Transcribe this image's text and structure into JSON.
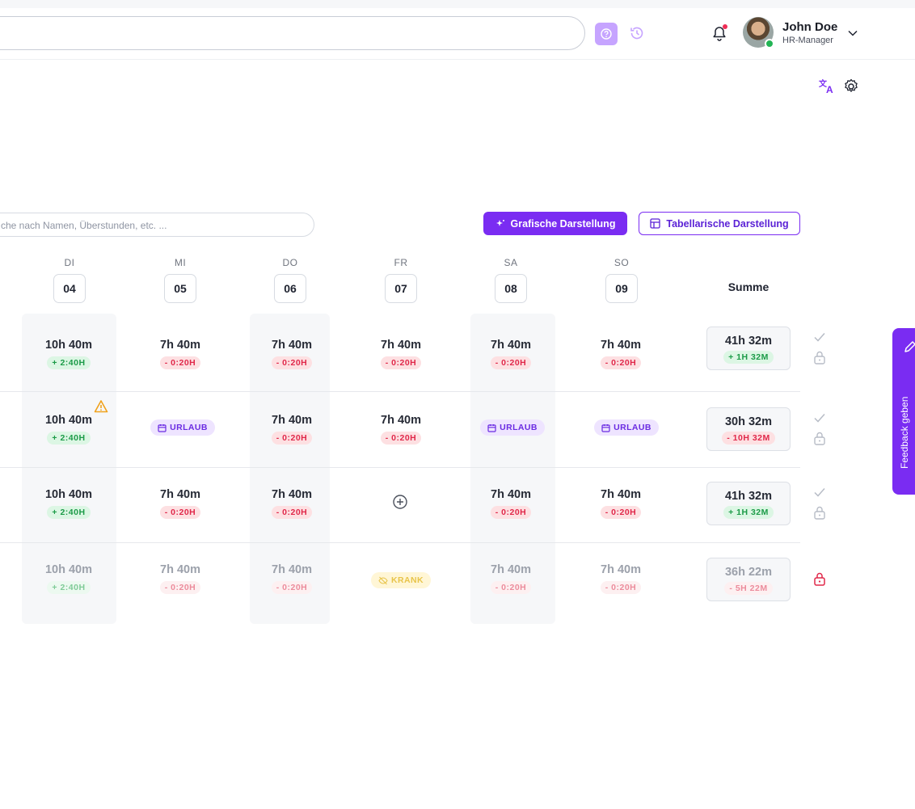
{
  "header": {
    "user": {
      "name": "John Doe",
      "role": "HR-Manager"
    },
    "icons": [
      "help-icon",
      "history-icon",
      "bell-icon",
      "chevron-down-icon",
      "translate-icon",
      "settings-icon"
    ]
  },
  "toolbar": {
    "search_placeholder": "che nach Namen, Überstunden, etc. ...",
    "graph_label": "Grafische Darstellung",
    "table_label": "Tabellarische Darstellung"
  },
  "days": [
    {
      "name": "DI",
      "num": "04"
    },
    {
      "name": "MI",
      "num": "05"
    },
    {
      "name": "DO",
      "num": "06"
    },
    {
      "name": "FR",
      "num": "07"
    },
    {
      "name": "SA",
      "num": "08"
    },
    {
      "name": "SO",
      "num": "09"
    }
  ],
  "sum_label": "Summe",
  "rows": [
    {
      "cells": [
        {
          "hours": "10h 40m",
          "delta": "+ 2:40H"
        },
        {
          "hours": "7h 40m",
          "delta": "- 0:20H"
        },
        {
          "hours": "7h 40m",
          "delta": "- 0:20H"
        },
        {
          "hours": "7h 40m",
          "delta": "- 0:20H"
        },
        {
          "hours": "7h 40m",
          "delta": "- 0:20H"
        },
        {
          "hours": "7h 40m",
          "delta": "- 0:20H"
        }
      ],
      "sum": {
        "hours": "41h 32m",
        "delta": "+ 1H 32M"
      }
    },
    {
      "cells": [
        {
          "hours": "10h 40m",
          "delta": "+ 2:40H"
        },
        {
          "tag": "URLAUB"
        },
        {
          "hours": "7h 40m",
          "delta": "- 0:20H"
        },
        {
          "hours": "7h 40m",
          "delta": "- 0:20H"
        },
        {
          "tag": "URLAUB"
        },
        {
          "tag": "URLAUB"
        }
      ],
      "sum": {
        "hours": "30h 32m",
        "delta": "- 10H 32M"
      }
    },
    {
      "cells": [
        {
          "hours": "10h 40m",
          "delta": "+ 2:40H"
        },
        {
          "hours": "7h 40m",
          "delta": "- 0:20H"
        },
        {
          "hours": "7h 40m",
          "delta": "- 0:20H"
        },
        {
          "empty": true
        },
        {
          "hours": "7h 40m",
          "delta": "- 0:20H"
        },
        {
          "hours": "7h 40m",
          "delta": "- 0:20H"
        }
      ],
      "sum": {
        "hours": "41h 32m",
        "delta": "+ 1H 32M"
      }
    },
    {
      "cells": [
        {
          "hours": "10h 40m",
          "delta": "+ 2:40H"
        },
        {
          "hours": "7h 40m",
          "delta": "- 0:20H"
        },
        {
          "hours": "7h 40m",
          "delta": "- 0:20H"
        },
        {
          "tag": "KRANK"
        },
        {
          "hours": "7h 40m",
          "delta": "- 0:20H"
        },
        {
          "hours": "7h 40m",
          "delta": "- 0:20H"
        }
      ],
      "sum": {
        "hours": "36h 22m",
        "delta": "- 5H 22M"
      }
    }
  ],
  "feedback": {
    "label": "Feedback geben"
  },
  "colors": {
    "accent": "#7a2cf2",
    "positive": "#1c9b48",
    "negative": "#e0284a",
    "lock_active": "#e0284a"
  }
}
